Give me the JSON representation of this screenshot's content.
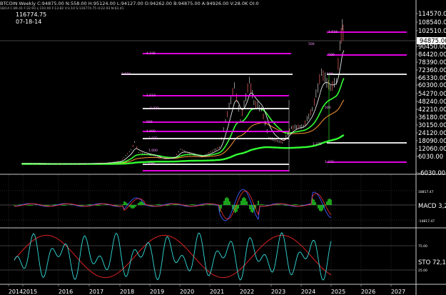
{
  "header": {
    "ohlc": "BTCOIN Weekly  C:94875.00  N:558.00  H:95124.00  L:94127.00  O:94262.00  B:94875.00  A:94926.00  V:28.0K  OI:0",
    "indicators": "18/14  C:89.41  F:32.93  L:110.00  F:13.82  V:3.10  S:116774.75  H:22.93  N:63.41",
    "cursor_price": "116774.75",
    "cursor_date": "07-18-14"
  },
  "price_axis": {
    "ticks": [
      "114570.00",
      "108540.00",
      "102510.00",
      "90450.00",
      "84420.00",
      "78390.00",
      "72360.00",
      "66330.00",
      "60300.00",
      "54270.00",
      "48240.00",
      "42210.00",
      "36180.00",
      "30150.00",
      "24120.00",
      "18090.00",
      "12060.00",
      "6030.00",
      "-6030.00"
    ],
    "current_price": "94875.00"
  },
  "macd_panel": {
    "label": "MACD 3,2",
    "upper_level": "18817.47",
    "lower_level": "-14817.47"
  },
  "sto_panel": {
    "label": "STO 72,1",
    "level_high": "75.00",
    "level_low": "25.00"
  },
  "time_axis": {
    "labels": [
      "2014",
      "2015",
      "2016",
      "2017",
      "2018",
      "2019",
      "2020",
      "2021",
      "2022",
      "2023",
      "2024",
      "2025",
      "2026",
      "2027"
    ]
  },
  "annotations": {
    "fib_labels": [
      {
        "text": "1.618"
      },
      {
        "text": "500"
      },
      {
        "text": "4.236"
      },
      {
        "text": "500"
      },
      {
        "text": "2.618"
      },
      {
        "text": "500"
      },
      {
        "text": "1.618"
      },
      {
        "text": "1.272"
      },
      {
        "text": "500"
      },
      {
        "text": "1.000"
      },
      {
        "text": "1.272"
      },
      {
        "text": "1.272"
      },
      {
        "text": "1.000"
      },
      {
        "text": "500"
      },
      {
        "text": "500"
      },
      {
        "text": "1.272"
      }
    ]
  },
  "colors": {
    "background": "#000000",
    "candles": "#c8c8c8",
    "ma_fast": "#ffffff",
    "ma_mid": "#33ff33",
    "ma_slow": "#ff9933",
    "fib_lines": "#ff00ff",
    "white_levels": "#ffffff",
    "macd_line": "#3b5bff",
    "macd_signal": "#ff3333",
    "macd_hist": "#22cc22",
    "sto_k": "#33dddd",
    "sto_d": "#dd2222"
  }
}
